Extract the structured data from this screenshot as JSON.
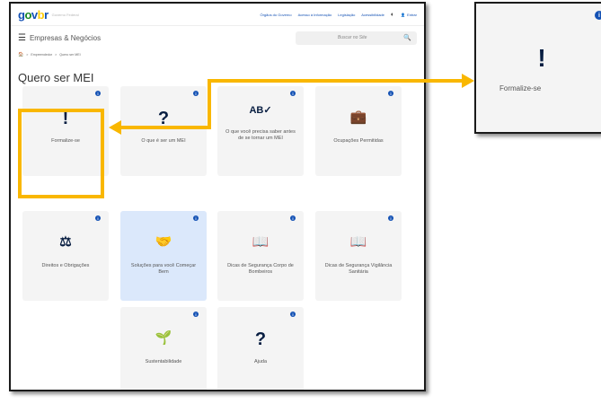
{
  "header": {
    "logo": {
      "g": "g",
      "o": "o",
      "v": "v",
      "b": "b",
      "r": "r"
    },
    "site_sub": "Governo Federal",
    "links": [
      "Órgãos do Governo",
      "Acesso à Informação",
      "Legislação",
      "Acessibilidade"
    ],
    "contrast_icon": "◐",
    "enter_icon": "👤",
    "enter_label": "Entrar"
  },
  "sitebar": {
    "menu_icon": "☰",
    "title": "Empresas & Negócios",
    "search_placeholder": "Buscar no Site",
    "search_icon": "🔍"
  },
  "breadcrumb": {
    "home_icon": "🏠",
    "items": [
      "Empreendedor",
      "Quero ser MEI"
    ],
    "separator": ">"
  },
  "page_title": "Quero ser MEI",
  "cards": [
    {
      "label": "Formalize-se",
      "icon": "!"
    },
    {
      "label": "O que é ser um MEI",
      "icon": "?"
    },
    {
      "label": "O que você precisa saber antes de se tornar um MEI",
      "icon": "AB✓"
    },
    {
      "label": "Ocupações Permitidas",
      "icon": "💼"
    },
    {
      "label": "Direitos e Obrigações",
      "icon": "⚖"
    },
    {
      "label": "Soluções para você Começar Bem",
      "icon": "🤝"
    },
    {
      "label": "Dicas de Segurança Corpo de Bombeiros",
      "icon": "📖"
    },
    {
      "label": "Dicas de Segurança Vigilância Sanitária",
      "icon": "📖"
    },
    {
      "label": "Sustentabilidade",
      "icon": "🌱"
    },
    {
      "label": "Ajuda",
      "icon": "?"
    }
  ],
  "info_glyph": "i",
  "popup": {
    "label": "Formalize-se",
    "icon": "!",
    "info": "i"
  },
  "colors": {
    "highlight": "#f9b700",
    "brand_blue": "#1351b4",
    "icon_dark": "#071d41",
    "active_card": "#dbe8fb"
  }
}
